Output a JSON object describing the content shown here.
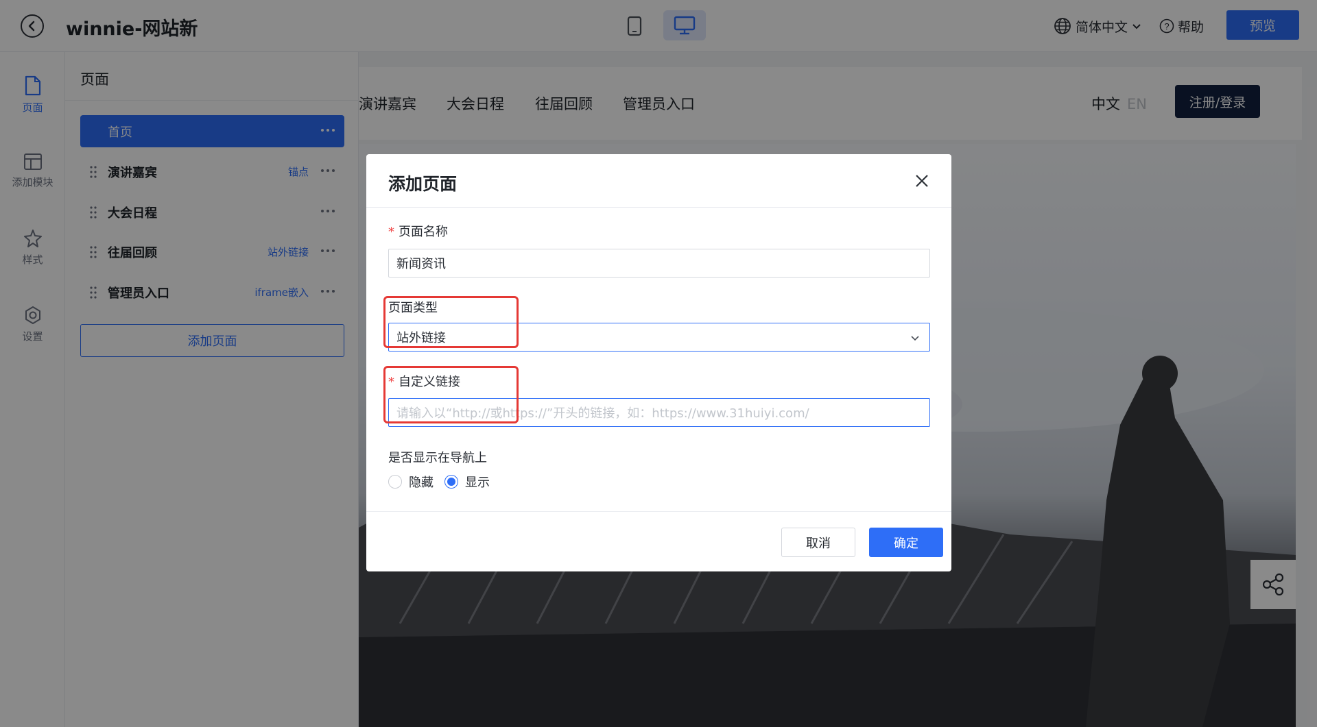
{
  "header": {
    "back_icon": "back-arrow-icon",
    "site_title": "winnie-网站新",
    "device_mobile_icon": "mobile-device-icon",
    "device_desktop_icon": "desktop-device-icon",
    "language": "简体中文",
    "help": "帮助",
    "preview": "预览"
  },
  "rail": {
    "items": [
      {
        "label": "页面",
        "icon": "page-icon",
        "active": true
      },
      {
        "label": "添加模块",
        "icon": "layout-icon",
        "active": false
      },
      {
        "label": "样式",
        "icon": "style-icon",
        "active": false
      },
      {
        "label": "设置",
        "icon": "settings-icon",
        "active": false
      }
    ]
  },
  "panel": {
    "title": "页面",
    "pages": [
      {
        "label": "首页",
        "tag": ""
      },
      {
        "label": "演讲嘉宾",
        "tag": "锚点"
      },
      {
        "label": "大会日程",
        "tag": ""
      },
      {
        "label": "往届回顾",
        "tag": "站外链接"
      },
      {
        "label": "管理员入口",
        "tag": "iframe嵌入"
      }
    ],
    "add_page": "添加页面"
  },
  "site": {
    "nav": [
      "演讲嘉宾",
      "大会日程",
      "往届回顾",
      "管理员入口"
    ],
    "lang_zh": "中文",
    "lang_en": "EN",
    "login": "注册/登录"
  },
  "modal": {
    "title": "添加页面",
    "name_label": "页面名称",
    "name_value": "新闻资讯",
    "type_label": "页面类型",
    "type_value": "站外链接",
    "link_label": "自定义链接",
    "link_placeholder": "请输入以“http://或https://”开头的链接，如：https://www.31huiyi.com/",
    "nav_label": "是否显示在导航上",
    "radio_hide": "隐藏",
    "radio_show": "显示",
    "selected": "显示",
    "cancel": "取消",
    "confirm": "确定"
  },
  "colors": {
    "accent": "#2e6ef7",
    "highlight": "#e53935",
    "required": "#f04848",
    "login_button": "#11203f"
  }
}
